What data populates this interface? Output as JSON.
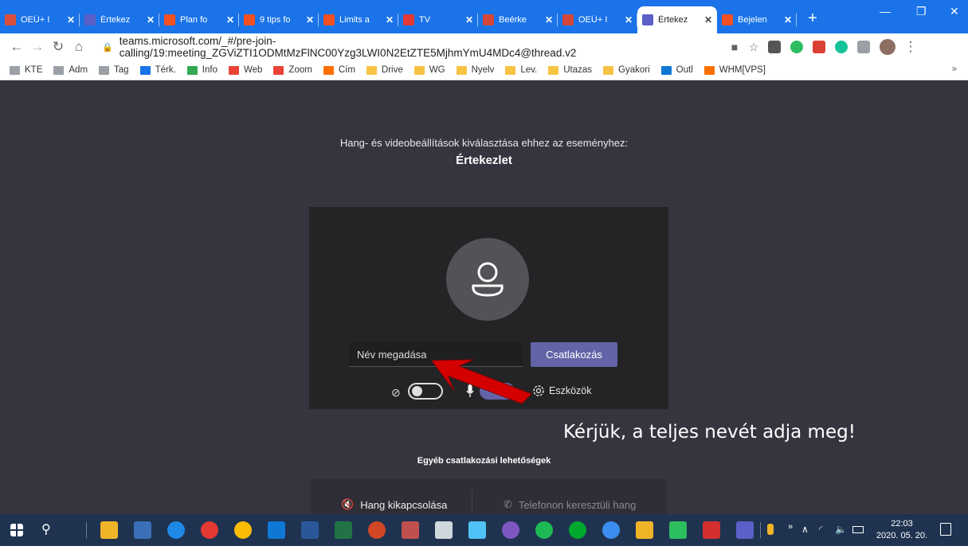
{
  "browser": {
    "tabs": [
      {
        "label": "OEÜ+ I",
        "color": "#d94f3d",
        "active": false
      },
      {
        "label": "Értekez",
        "color": "#5b5fc7",
        "active": false
      },
      {
        "label": "Plan fo",
        "color": "#f25022",
        "active": false
      },
      {
        "label": "9 tips fo",
        "color": "#f25022",
        "active": false
      },
      {
        "label": "Limits a",
        "color": "#f25022",
        "active": false
      },
      {
        "label": "TV",
        "color": "#e53935",
        "active": false
      },
      {
        "label": "Beérke",
        "color": "#d44638",
        "active": false
      },
      {
        "label": "OEÜ+ I",
        "color": "#d44638",
        "active": false
      },
      {
        "label": "Értekez",
        "color": "#5b5fc7",
        "active": true
      },
      {
        "label": "Bejelen",
        "color": "#f25022",
        "active": false
      }
    ],
    "url": "teams.microsoft.com/_#/pre-join-calling/19:meeting_ZGViZTI1ODMtMzFlNC00Yzg3LWI0N2EtZTE5MjhmYmU4MDc4@thread.v2",
    "bookmarks": [
      "KTE",
      "Adm",
      "Tag",
      "Térk.",
      "Info",
      "Web",
      "Zoom",
      "Cím",
      "Drive",
      "WG",
      "Nyelv",
      "Lev.",
      "Utazas",
      "Gyakori",
      "Outl",
      "WHM[VPS]"
    ],
    "bookmarks_more": "»"
  },
  "teams": {
    "prompt": "Hang- és videobeállítások kiválasztása ehhez az eseményhez:",
    "meeting_title": "Értekezlet",
    "name_placeholder": "Név megadása",
    "join_label": "Csatlakozás",
    "devices_label": "Eszközök",
    "camera_on": false,
    "mic_on": true,
    "other_options_title": "Egyéb csatlakozási lehetőségek",
    "audio_off_label": "Hang kikapcsolása",
    "phone_audio_label": "Telefonon keresztüli hang"
  },
  "annotation": {
    "text": "Kérjük, a teljes nevét adja meg!",
    "arrow_color": "#d40000"
  },
  "taskbar": {
    "time": "22:03",
    "date": "2020. 05. 20."
  }
}
